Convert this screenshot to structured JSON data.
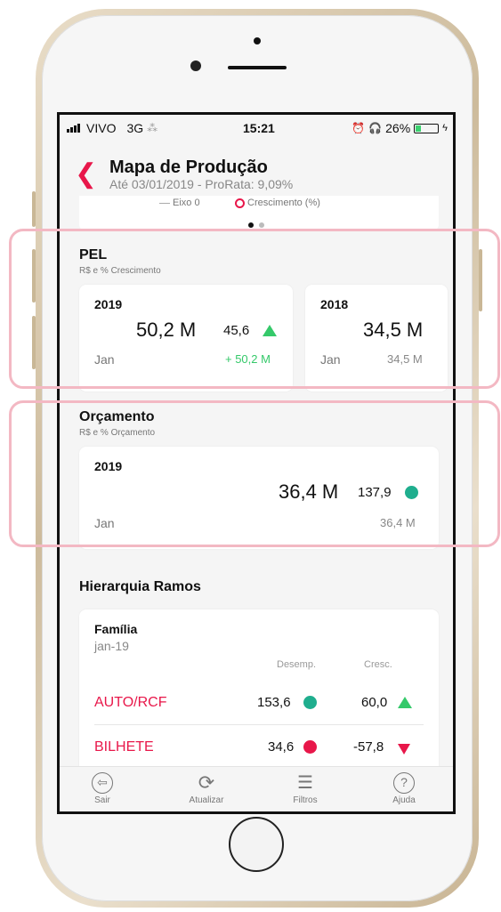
{
  "status_bar": {
    "carrier": "VIVO",
    "network": "3G",
    "time": "15:21",
    "battery": "26%",
    "battery_level": 0.26
  },
  "header": {
    "title": "Mapa de Produção",
    "subtitle": "Até 03/01/2019 - ProRata: 9,09%"
  },
  "chart_legend": {
    "eixo": "Eixo 0",
    "crescimento": "Crescimento (%)"
  },
  "pel": {
    "title": "PEL",
    "subtitle": "R$ e % Crescimento",
    "card_2019": {
      "year": "2019",
      "value": "50,2 M",
      "growth": "45,6",
      "month": "Jan",
      "delta": "+ 50,2 M"
    },
    "card_2018": {
      "year": "2018",
      "value": "34,5 M",
      "month": "Jan",
      "month_value": "34,5 M"
    }
  },
  "orcamento": {
    "title": "Orçamento",
    "subtitle": "R$ e % Orçamento",
    "card_2019": {
      "year": "2019",
      "value": "36,4 M",
      "pct": "137,9",
      "month": "Jan",
      "month_value": "36,4 M"
    }
  },
  "hierarquia": {
    "title": "Hierarquia Ramos",
    "family_label": "Família",
    "period": "jan-19",
    "col_desemp": "Desemp.",
    "col_cresc": "Cresc.",
    "rows": [
      {
        "name": "AUTO/RCF",
        "desemp": "153,6",
        "cresc": "60,0"
      },
      {
        "name": "BILHETE",
        "desemp": "34,6",
        "cresc": "-57,8"
      }
    ]
  },
  "tabbar": {
    "sair": "Sair",
    "atualizar": "Atualizar",
    "filtros": "Filtros",
    "ajuda": "Ajuda"
  },
  "colors": {
    "accent": "#e8174a",
    "green": "#35c96a",
    "teal": "#1fae8e",
    "highlight": "#f3b8c3"
  }
}
